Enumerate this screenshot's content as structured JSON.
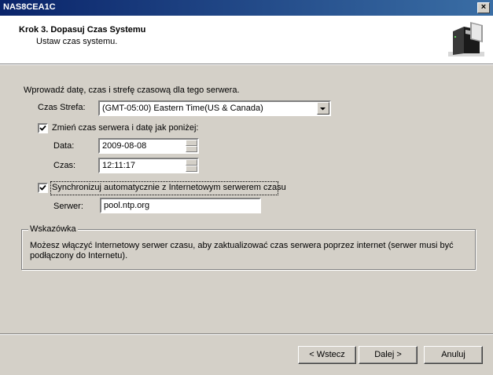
{
  "window": {
    "title": "NAS8CEA1C",
    "close_glyph": "×"
  },
  "header": {
    "step_title": "Krok 3. Dopasuj Czas Systemu",
    "subtitle": "Ustaw czas systemu."
  },
  "form": {
    "intro": "Wprowadź datę, czas i strefę czasową dla tego serwera.",
    "timezone_label": "Czas Strefa:",
    "timezone_value": "(GMT-05:00) Eastern Time(US & Canada)",
    "change_time_label": "Zmień czas serwera i datę jak poniżej:",
    "change_time_checked": true,
    "date_label": "Data:",
    "date_value": "2009-08-08",
    "time_label": "Czas:",
    "time_value": "12:11:17",
    "sync_label": "Synchronizuj automatycznie z Internetowym serwerem czasu",
    "sync_checked": true,
    "server_label": "Serwer:",
    "server_value": "pool.ntp.org"
  },
  "hint": {
    "title": "Wskazówka",
    "line1": "Możesz włączyć Internetowy serwer czasu, aby zaktualizować czas serwera poprzez internet (serwer musi być",
    "line2": "podłączony do Internetu)."
  },
  "buttons": {
    "back": "< Wstecz",
    "next": "Dalej >",
    "cancel": "Anuluj"
  }
}
